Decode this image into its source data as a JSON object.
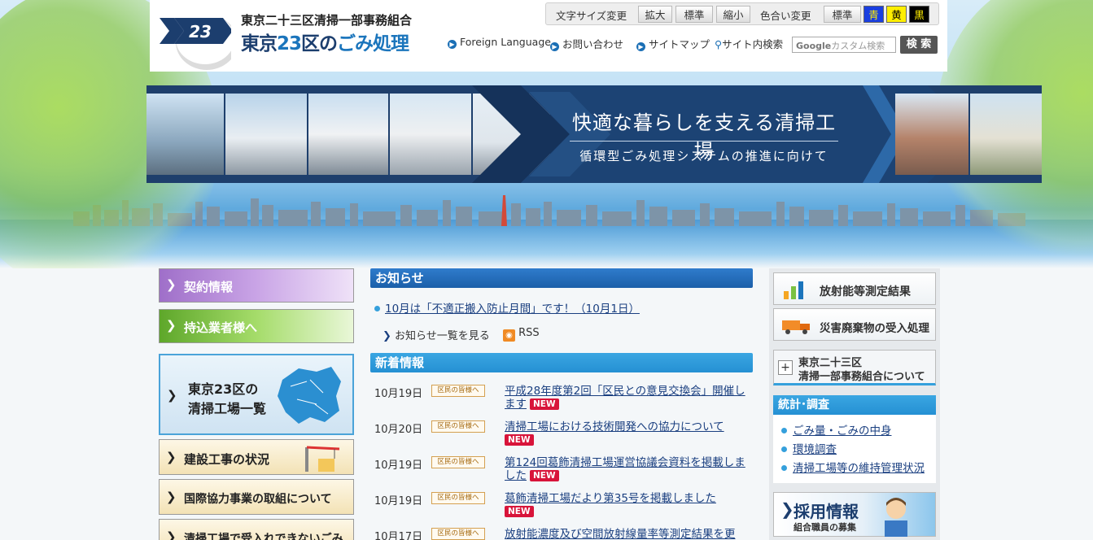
{
  "header": {
    "badge_number": "23",
    "org_name": "東京二十三区清掃一部事務組合",
    "site_title_pre": "東京",
    "site_title_num": "23",
    "site_title_mid": "区の",
    "site_title_post": "ごみ処理",
    "font_size_label": "文字サイズ変更",
    "font_sizes": [
      "拡大",
      "標準",
      "縮小"
    ],
    "color_label": "色合い変更",
    "color_options": [
      "標準",
      "青",
      "黄",
      "黒"
    ],
    "nav": [
      "Foreign Language",
      "お問い合わせ",
      "サイトマップ",
      "サイト内検索"
    ],
    "search_placeholder": "カスタム検索",
    "search_brand": "Google",
    "search_button": "検 索"
  },
  "banner": {
    "title": "快適な暮らしを支える清掃工場",
    "subtitle": "循環型ごみ処理システムの推進に向けて"
  },
  "left_nav": [
    "契約情報",
    "持込業者様へ",
    "東京23区の",
    "清掃工場一覧",
    "建設工事の状況",
    "国際協力事業の取組について",
    "清掃工場で受入れできないごみ"
  ],
  "notices": {
    "heading": "お知らせ",
    "item": "10月は「不適正搬入防止月間」です！（10月1日）",
    "list_link": "お知らせ一覧を見る",
    "rss": "RSS"
  },
  "news": {
    "heading": "新着情報",
    "tag_label": "区民の皆様へ",
    "new_label": "NEW",
    "items": [
      {
        "date": "10月19日",
        "text": "平成28年度第2回「区民との意見交換会」開催します"
      },
      {
        "date": "10月20日",
        "text": "清掃工場における技術開発への協力について"
      },
      {
        "date": "10月19日",
        "text": "第124回葛飾清掃工場運営協議会資料を掲載しました"
      },
      {
        "date": "10月19日",
        "text": "葛飾清掃工場だより第35号を掲載しました"
      },
      {
        "date": "10月17日",
        "text": "放射能濃度及び空間放射線量率等測定結果を更"
      }
    ]
  },
  "right": {
    "radiation": "放射能等測定結果",
    "disaster": "災害廃棄物の受入処理",
    "about_line1": "東京二十三区",
    "about_line2": "清掃一部事務組合について",
    "stats_heading": "統計･調査",
    "stats_links": [
      "ごみ量・ごみの中身",
      "環境調査",
      "清掃工場等の維持管理状況"
    ],
    "recruit_title": "採用情報",
    "recruit_sub": "組合職員の募集"
  },
  "colors": {
    "navy": "#1c3e6e",
    "blue": "#1b75bc",
    "sky_blue": "#35a0dc",
    "new_red": "#d8143a",
    "purple": "#b77fd6",
    "green": "#8fd24a"
  }
}
